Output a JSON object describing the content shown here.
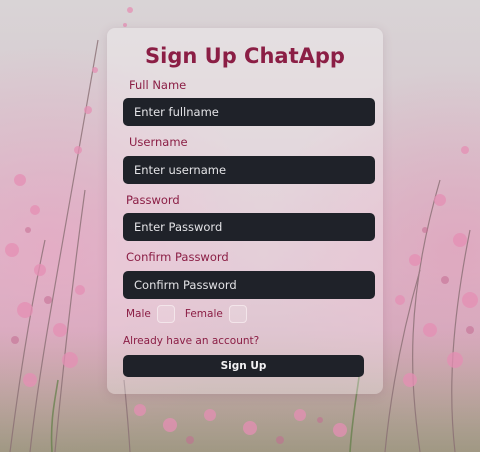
{
  "form": {
    "title": "Sign Up ChatApp",
    "fullname_label": "Full Name",
    "fullname_placeholder": "Enter fullname",
    "username_label": "Username",
    "username_placeholder": "Enter username",
    "password_label": "Password",
    "password_placeholder": "Enter Password",
    "confirm_label": "Confirm Password",
    "confirm_placeholder": "Confirm Password",
    "gender_male": "Male",
    "gender_female": "Female",
    "login_link": "Already have an account?",
    "submit_label": "Sign Up"
  },
  "colors": {
    "accent": "#8b1e45",
    "input_bg": "#1f2229",
    "background": "#d8bfc9"
  }
}
